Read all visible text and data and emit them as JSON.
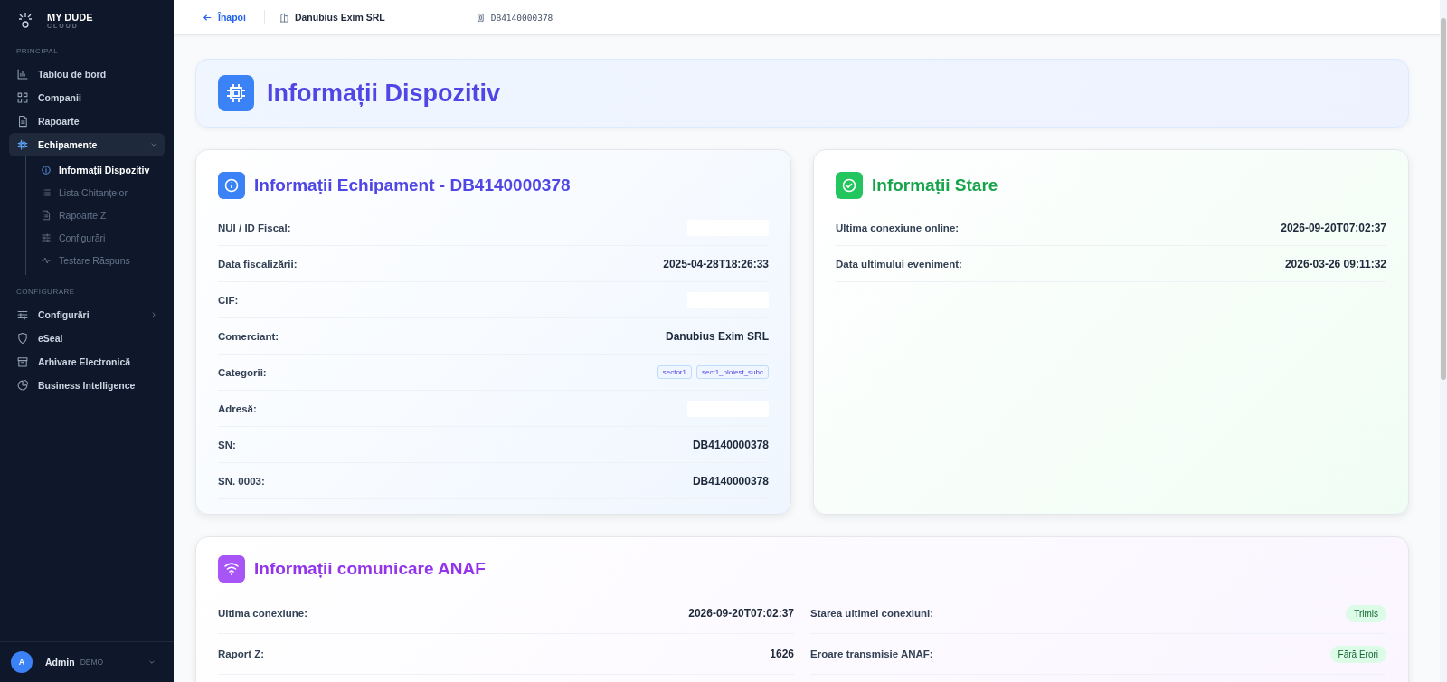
{
  "brand": {
    "name": "MY DUDE",
    "subtitle": "CLOUD"
  },
  "sidebar": {
    "sections": [
      {
        "title": "PRINCIPAL",
        "items": [
          {
            "label": "Tablou de bord",
            "selected": false
          },
          {
            "label": "Companii",
            "selected": false
          },
          {
            "label": "Rapoarte",
            "selected": false
          },
          {
            "label": "Echipamente",
            "selected": true,
            "expanded": true,
            "children": [
              {
                "label": "Informații Dispozitiv",
                "selected": true
              },
              {
                "label": "Lista Chitanțelor",
                "selected": false
              },
              {
                "label": "Rapoarte Z",
                "selected": false
              },
              {
                "label": "Configurări",
                "selected": false
              },
              {
                "label": "Testare Răspuns",
                "selected": false
              }
            ]
          }
        ]
      },
      {
        "title": "CONFIGURARE",
        "items": [
          {
            "label": "Configurări",
            "selected": false,
            "expanded": false
          },
          {
            "label": "eSeal",
            "selected": false
          },
          {
            "label": "Arhivare Electronică",
            "selected": false
          },
          {
            "label": "Business Intelligence",
            "selected": false
          }
        ]
      }
    ]
  },
  "user": {
    "initial": "A",
    "name": "Admin",
    "role": "DEMO"
  },
  "topbar": {
    "back": "Înapoi",
    "company": "Danubius Exim SRL",
    "device": "DB4140000378"
  },
  "page_title": "Informații Dispozitiv",
  "cards": [
    {
      "title": "Informații Echipament - DB4140000378",
      "rows": [
        {
          "label": "NUI / ID Fiscal:",
          "kind": "redacted"
        },
        {
          "label": "Data fiscalizării:",
          "kind": "text",
          "value": "2025-04-28T18:26:33"
        },
        {
          "label": "CIF:",
          "kind": "redacted"
        },
        {
          "label": "Comerciant:",
          "kind": "text",
          "value": "Danubius Exim SRL"
        },
        {
          "label": "Categorii:",
          "kind": "tags",
          "tags": [
            "sector1",
            "sect1_ploiest_subc"
          ]
        },
        {
          "label": "Adresă:",
          "kind": "redacted"
        },
        {
          "label": "SN:",
          "kind": "text",
          "value": "DB4140000378"
        },
        {
          "label": "SN. 0003:",
          "kind": "text",
          "value": "DB4140000378"
        }
      ]
    },
    {
      "title": "Informații Stare",
      "rows": [
        {
          "label": "Ultima conexiune online:",
          "kind": "text",
          "value": "2026-09-20T07:02:37"
        },
        {
          "label": "Data ultimului eveniment:",
          "kind": "text",
          "value": "2026-03-26 09:11:32"
        }
      ]
    }
  ],
  "anaf": {
    "title": "Informații comunicare ANAF",
    "left": [
      {
        "label": "Ultima conexiune:",
        "kind": "text",
        "value": "2026-09-20T07:02:37"
      },
      {
        "label": "Raport Z:",
        "kind": "text",
        "value": "1626"
      }
    ],
    "right": [
      {
        "label": "Starea ultimei conexiuni:",
        "kind": "status",
        "value": "Trimis"
      },
      {
        "label": "Eroare transmisie ANAF:",
        "kind": "status",
        "value": "Fără Erori"
      }
    ]
  }
}
